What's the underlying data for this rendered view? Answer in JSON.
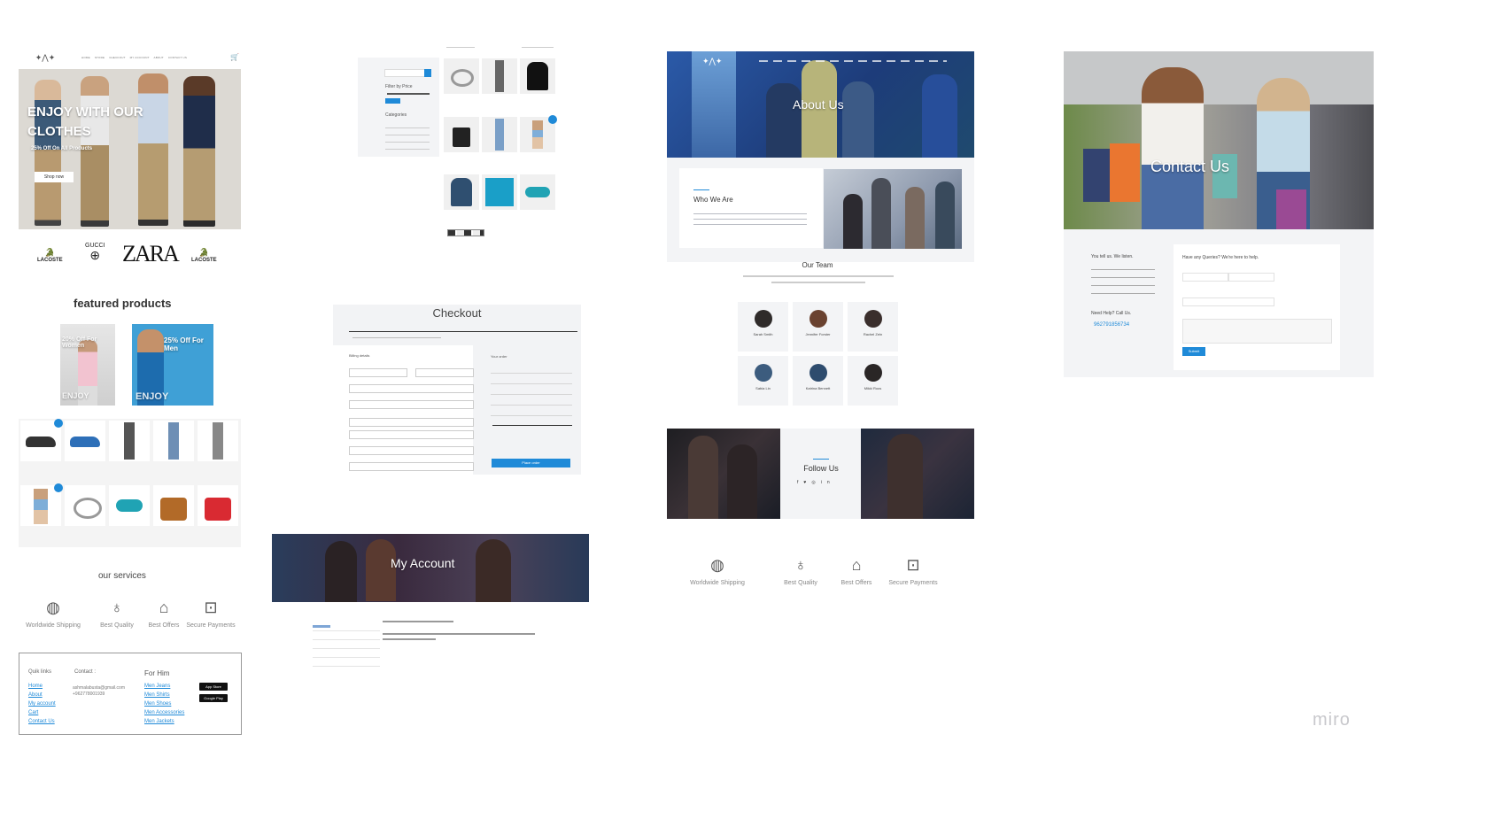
{
  "home": {
    "nav": [
      "HOME",
      "STORE",
      "CHECKOUT",
      "MY ACCOUNT",
      "ABOUT",
      "CONTACT US"
    ],
    "hero_title_1": "ENJOY WITH OUR",
    "hero_title_2": "CLOTHES",
    "hero_sub": "25% Off On All Products",
    "hero_btn": "Shop now",
    "brands": [
      "LACOSTE",
      "GUCCI",
      "ZARA",
      "LACOSTE"
    ],
    "featured_title": "featured products",
    "promo_women": "20% Off For Women",
    "promo_men": "25% Off For Men",
    "promo_enjoy": "ENJOY",
    "services_title": "our services",
    "services": [
      "Worldwide Shipping",
      "Best Quality",
      "Best Offers",
      "Secure Payments"
    ],
    "footer": {
      "quick_links_title": "Quik links",
      "quick_links": [
        "Home",
        "About",
        "My account",
        "Cart",
        "Contact Us"
      ],
      "contact_title": "Contact :",
      "email": "ashmalabusta@gmail.com",
      "phone": "+962778001939",
      "for_him_title": "For Him",
      "for_him": [
        "Men Jeans",
        "Men Shirts",
        "Men Shoes",
        "Men Accessories",
        "Men Jackets"
      ],
      "app_store": "App Store",
      "google_play": "Google Play"
    }
  },
  "shop": {
    "filter_title": "Filter by Price",
    "categories_title": "Categories"
  },
  "checkout": {
    "title": "Checkout",
    "billing_title": "Billing details",
    "order_title": "Your order",
    "place_order": "Place order"
  },
  "account": {
    "title": "My Account"
  },
  "about": {
    "title": "About Us",
    "who_title": "Who We Are",
    "team_title": "Our Team",
    "team": [
      "Sarah Smith",
      "Jennifer Forster",
      "Rachel Zeln",
      "Sabia Lin",
      "Katrina Bennett",
      "Mikki Roos"
    ],
    "follow_title": "Follow Us",
    "services": [
      "Worldwide Shipping",
      "Best Quality",
      "Best Offers",
      "Secure Payments"
    ]
  },
  "contact": {
    "title": "Contact Us",
    "listen": "You tell us. We listen.",
    "help_title": "Need Help? Call Us.",
    "phone": "962791856734",
    "form_title": "Have any Queries? We're here to help.",
    "submit": "Submit"
  },
  "watermark": "miro",
  "colors": {
    "accent": "#1f8ad8",
    "navy": "#1d3c7a"
  }
}
